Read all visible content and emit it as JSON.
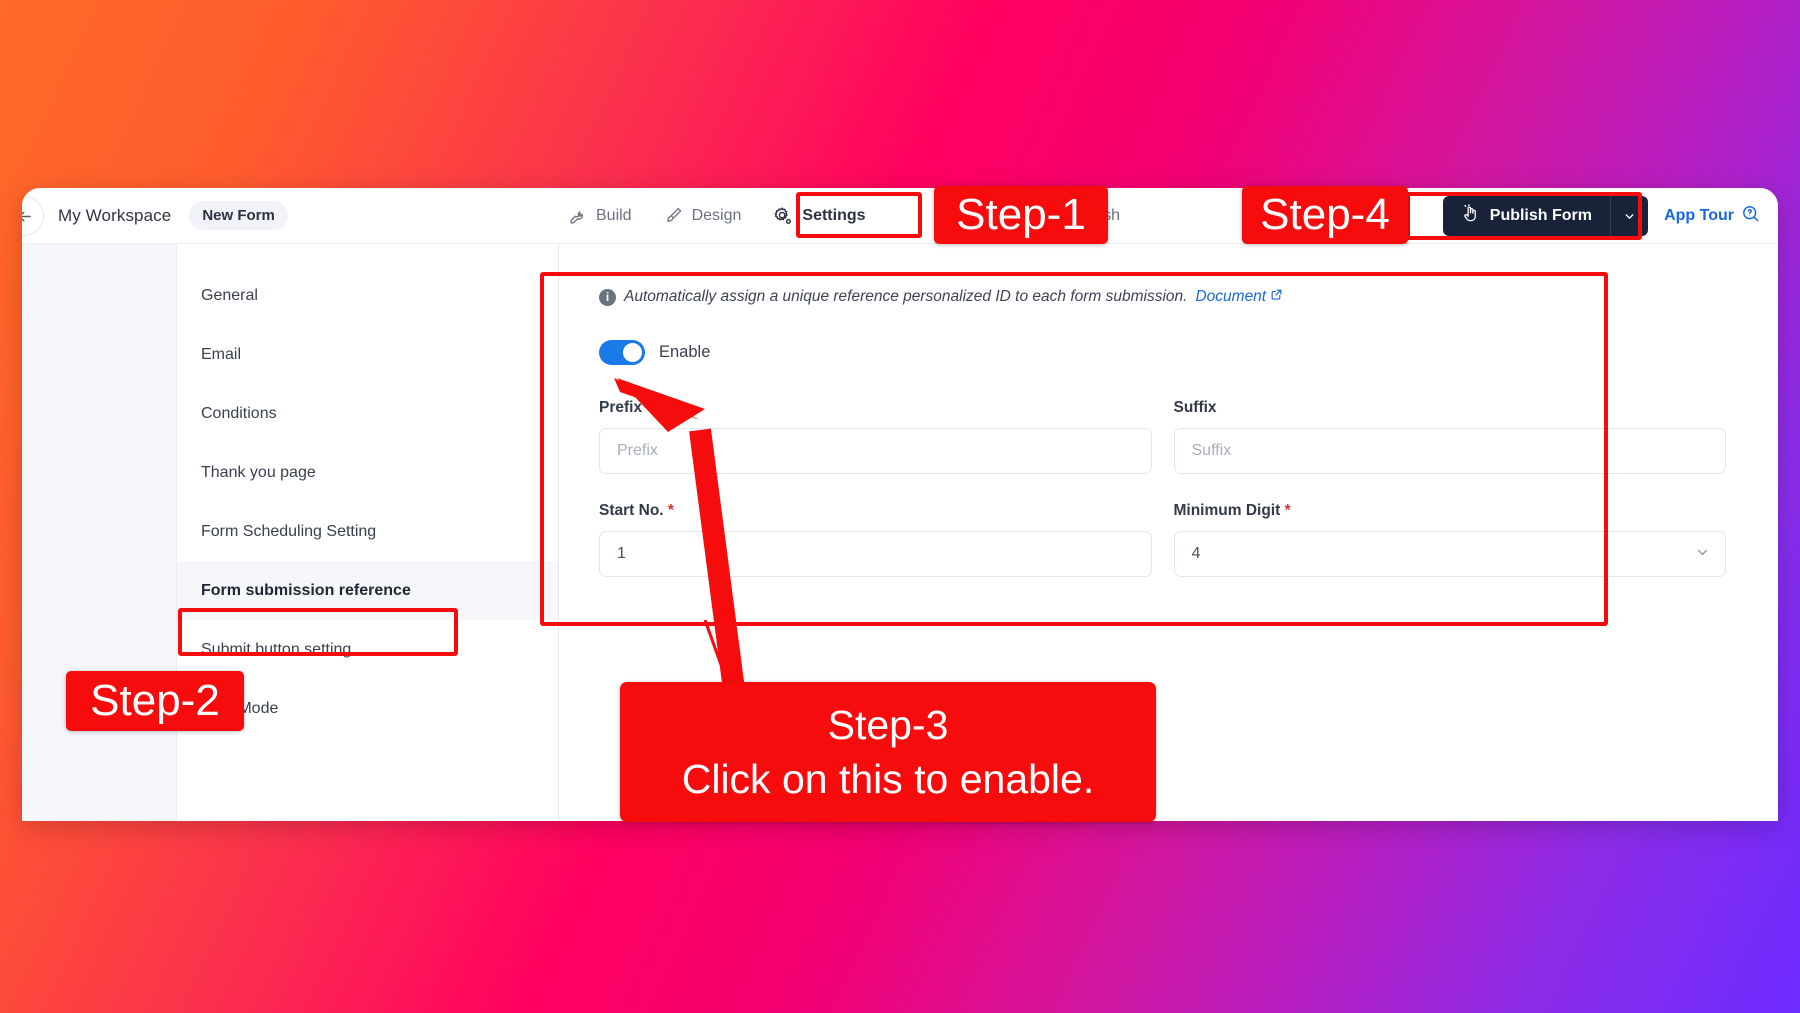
{
  "header": {
    "back_icon": "arrow-left-icon",
    "workspace": "My Workspace",
    "form_name": "New Form",
    "tabs": [
      {
        "label": "Build",
        "icon": "wrench-icon",
        "active": false
      },
      {
        "label": "Design",
        "icon": "brush-icon",
        "active": false
      },
      {
        "label": "Settings",
        "icon": "gear-icon",
        "active": true
      },
      {
        "label": "Publish",
        "icon": "",
        "active": false
      }
    ],
    "publish_button": {
      "label": "Publish Form",
      "icon": "pointing-hand-icon",
      "caret": "⌄"
    },
    "app_tour": {
      "label": "App Tour",
      "icon": "help-circle-icon"
    }
  },
  "sidebar": {
    "items": [
      {
        "label": "General",
        "active": false
      },
      {
        "label": "Email",
        "active": false
      },
      {
        "label": "Conditions",
        "active": false
      },
      {
        "label": "Thank you page",
        "active": false
      },
      {
        "label": "Form Scheduling Setting",
        "active": false
      },
      {
        "label": "Form submission reference",
        "active": true
      },
      {
        "label": "Submit button setting",
        "active": false
      },
      {
        "label": "Quiz Mode",
        "active": false
      }
    ]
  },
  "content": {
    "info_icon": "info-icon",
    "info_text": "Automatically assign a unique reference personalized ID to each form submission.",
    "doc_link": "Document",
    "external_link_icon": "external-link-icon",
    "toggle": {
      "label": "Enable",
      "state": "on",
      "color": "#1a7ae8"
    },
    "fields": [
      {
        "label": "Prefix",
        "required": false,
        "value": "",
        "placeholder": "Prefix",
        "type": "text"
      },
      {
        "label": "Suffix",
        "required": false,
        "value": "",
        "placeholder": "Suffix",
        "type": "text"
      },
      {
        "label": "Start No.",
        "required": true,
        "value": "1",
        "placeholder": "",
        "type": "text"
      },
      {
        "label": "Minimum Digit",
        "required": true,
        "value": "4",
        "placeholder": "",
        "type": "select",
        "caret": "⌄"
      }
    ]
  },
  "annotations": {
    "highlight_color": "#f60c0c",
    "badges": [
      {
        "id": "step-1",
        "text": "Step-1"
      },
      {
        "id": "step-2",
        "text": "Step-2"
      },
      {
        "id": "step-4",
        "text": "Step-4"
      }
    ],
    "callout": {
      "title": "Step-3",
      "body": "Click on this to enable."
    }
  },
  "theme": {
    "background_gradient_from": "#ff6a28",
    "background_gradient_mid": "#ff0060",
    "background_gradient_to": "#6c2bff",
    "accent_blue": "#1668e3",
    "dark_button": "#18233a"
  }
}
